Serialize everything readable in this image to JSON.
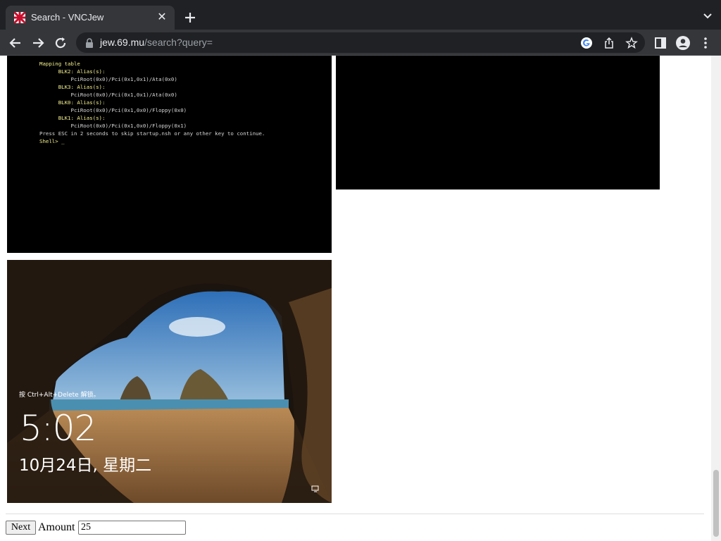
{
  "browser": {
    "tab_title": "Search - VNCJew",
    "url_host": "jew.69.mu",
    "url_path": "/search?query="
  },
  "results": {
    "console_lines": [
      {
        "text": "Mapping table",
        "style": "yel"
      },
      {
        "text": "      BLK2: Alias(s):",
        "style": "yel"
      },
      {
        "text": "          PciRoot(0x0)/Pci(0x1,0x1)/Ata(0x0)",
        "style": ""
      },
      {
        "text": "      BLK3: Alias(s):",
        "style": "yel"
      },
      {
        "text": "          PciRoot(0x0)/Pci(0x1,0x1)/Ata(0x0)",
        "style": ""
      },
      {
        "text": "      BLK0: Alias(s):",
        "style": "yel"
      },
      {
        "text": "          PciRoot(0x0)/Pci(0x1,0x0)/Floppy(0x0)",
        "style": ""
      },
      {
        "text": "      BLK1: Alias(s):",
        "style": "yel"
      },
      {
        "text": "          PciRoot(0x0)/Pci(0x1,0x0)/Floppy(0x1)",
        "style": ""
      },
      {
        "text": "Press ESC in 2 seconds to skip startup.nsh or any other key to continue.",
        "style": ""
      },
      {
        "text": "Shell> _",
        "style": "yel"
      }
    ],
    "lock_hint": "按 Ctrl+Alt+Delete 解锁。",
    "lock_time": "5:02",
    "lock_date": "10月24日, 星期二"
  },
  "footer": {
    "next_label": "Next",
    "amount_label": "Amount",
    "amount_value": "25"
  },
  "colors": {
    "tab_bg": "#35363a",
    "tabstrip_bg": "#202124",
    "omnibox_bg": "#202124"
  }
}
